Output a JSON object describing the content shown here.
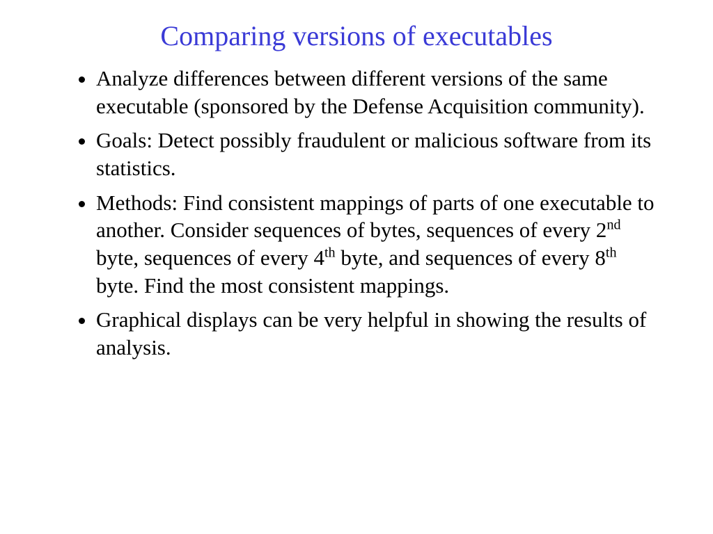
{
  "title": "Comparing versions of executables",
  "bullets": {
    "b0": "Analyze differences between different versions of the same executable (sponsored by the Defense Acquisition community).",
    "b1": "Goals: Detect possibly fraudulent or malicious software from its statistics.",
    "b2_a": "Methods: Find consistent mappings of parts of one executable to another.  Consider sequences of bytes, sequences of every 2",
    "b2_sup1": "nd",
    "b2_b": " byte, sequences of every 4",
    "b2_sup2": "th",
    "b2_c": " byte, and sequences of every 8",
    "b2_sup3": "th",
    "b2_d": " byte.   Find the most consistent mappings.",
    "b3": "Graphical displays can be very helpful in showing the results of analysis."
  }
}
